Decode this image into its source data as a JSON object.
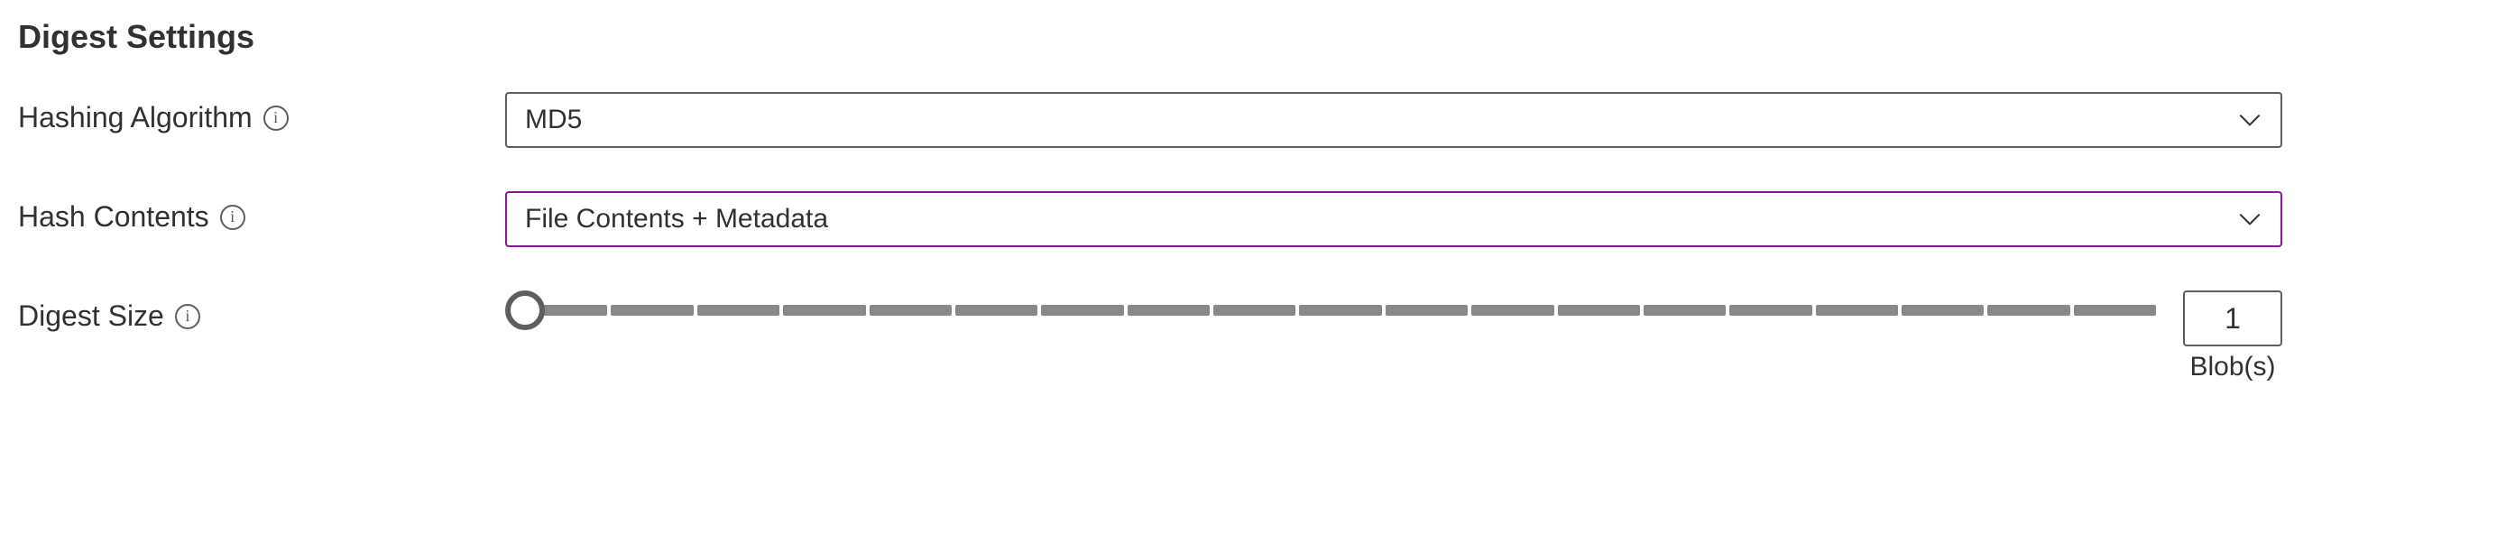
{
  "section": {
    "title": "Digest Settings"
  },
  "hashingAlgorithm": {
    "label": "Hashing Algorithm",
    "value": "MD5"
  },
  "hashContents": {
    "label": "Hash Contents",
    "value": "File Contents + Metadata"
  },
  "digestSize": {
    "label": "Digest Size",
    "value": "1",
    "unit": "Blob(s)"
  },
  "colors": {
    "focusBorder": "#881798",
    "defaultBorder": "#605e5c"
  }
}
